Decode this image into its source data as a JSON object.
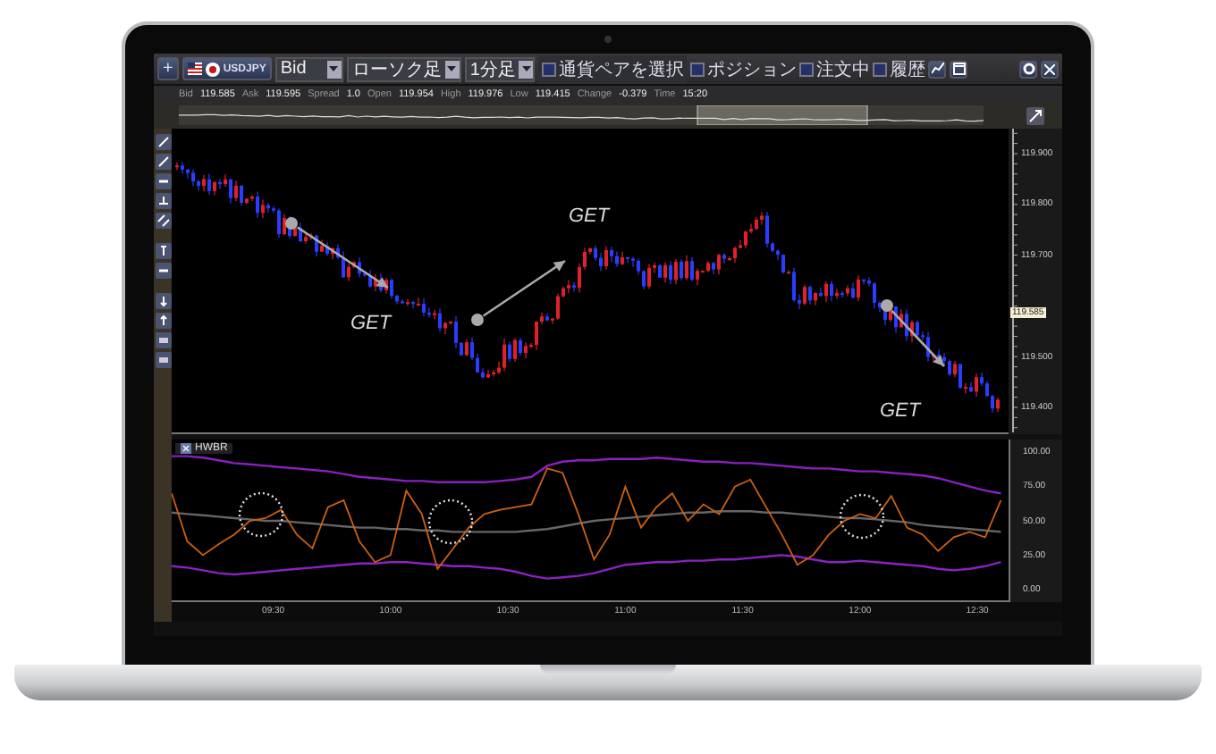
{
  "toolbar": {
    "add_button": "+",
    "pair": "USDJPY",
    "selects": [
      {
        "value": "Bid"
      },
      {
        "value": "ローソク足"
      },
      {
        "value": "1分足"
      }
    ],
    "pair_filter": {
      "label": "通貨ペアを選択",
      "checked": false
    },
    "toggles": [
      {
        "label": "ポジション",
        "checked": false
      },
      {
        "label": "注文中",
        "checked": false
      },
      {
        "label": "履歴",
        "checked": false
      }
    ]
  },
  "quote": [
    {
      "label": "Bid",
      "value": "119.585"
    },
    {
      "label": "Ask",
      "value": "119.595"
    },
    {
      "label": "Spread",
      "value": "1.0"
    },
    {
      "label": "Open",
      "value": "119.954"
    },
    {
      "label": "High",
      "value": "119.976"
    },
    {
      "label": "Low",
      "value": "119.415"
    },
    {
      "label": "Change",
      "value": "-0.379"
    },
    {
      "label": "Time",
      "value": "15:20"
    }
  ],
  "price_chart": {
    "axis_labels": [
      "119.900",
      "119.800",
      "119.700",
      "119.500",
      "119.400"
    ],
    "current_price": "119.585",
    "annotations": [
      {
        "text": "GET"
      },
      {
        "text": "GET"
      },
      {
        "text": "GET"
      }
    ]
  },
  "indicator": {
    "name": "HWBR",
    "chart_data": {
      "type": "line",
      "x": [
        9.067,
        9.133,
        9.2,
        9.267,
        9.333,
        9.4,
        9.467,
        9.533,
        9.6,
        9.667,
        9.733,
        9.8,
        9.867,
        9.933,
        10,
        10.067,
        10.133,
        10.2,
        10.267,
        10.333,
        10.4,
        10.467,
        10.533,
        10.6,
        10.667,
        10.733,
        10.8,
        10.867,
        10.933,
        11,
        11.067,
        11.133,
        11.2,
        11.267,
        11.333,
        11.4,
        11.467,
        11.533,
        11.6,
        11.667,
        11.733,
        11.8,
        11.867,
        11.933,
        12,
        12.067,
        12.133,
        12.2,
        12.267,
        12.333,
        12.4,
        12.467,
        12.533,
        12.6
      ],
      "series": [
        {
          "color": "#8a20c0",
          "values": [
            97,
            97,
            96,
            94,
            92,
            91,
            90,
            89,
            88,
            87,
            86,
            84,
            82,
            81,
            80,
            79,
            79,
            78,
            78,
            78,
            78,
            79,
            80,
            82,
            90,
            93,
            94,
            94,
            95,
            95,
            95,
            96,
            95,
            94,
            93,
            93,
            92,
            92,
            91,
            90,
            89,
            88,
            88,
            87,
            86,
            86,
            85,
            84,
            83,
            81,
            78,
            75,
            72,
            70
          ]
        },
        {
          "color": "#8c22c4",
          "values": [
            17,
            16,
            14,
            12,
            11,
            12,
            13,
            14,
            15,
            16,
            17,
            18,
            19,
            19,
            20,
            20,
            19,
            18,
            17,
            17,
            16,
            15,
            13,
            10,
            8,
            9,
            10,
            12,
            15,
            18,
            19,
            20,
            20,
            21,
            21,
            22,
            22,
            23,
            24,
            25,
            24,
            22,
            20,
            20,
            21,
            20,
            19,
            18,
            17,
            15,
            14,
            15,
            17,
            20
          ]
        },
        {
          "color": "#666666",
          "values": [
            56,
            55,
            54,
            53,
            52,
            51,
            50,
            50,
            49,
            48,
            47,
            46,
            45,
            45,
            44,
            44,
            43,
            43,
            42,
            42,
            42,
            42,
            42,
            43,
            44,
            46,
            48,
            50,
            51,
            52,
            53,
            54,
            55,
            56,
            56,
            57,
            57,
            57,
            56,
            56,
            55,
            54,
            53,
            52,
            52,
            51,
            50,
            49,
            47,
            46,
            45,
            44,
            43,
            42
          ]
        },
        {
          "color": "#d06010",
          "values": [
            70,
            35,
            25,
            33,
            40,
            50,
            52,
            58,
            40,
            30,
            60,
            65,
            35,
            20,
            25,
            72,
            55,
            15,
            30,
            45,
            55,
            58,
            60,
            62,
            88,
            85,
            55,
            22,
            40,
            75,
            45,
            60,
            70,
            50,
            62,
            55,
            75,
            80,
            60,
            40,
            18,
            25,
            40,
            50,
            55,
            52,
            68,
            45,
            40,
            28,
            38,
            42,
            38,
            65
          ]
        }
      ],
      "xlim": [
        9.067,
        12.633
      ],
      "ylim": [
        -9.1,
        109.1
      ],
      "xticks": [
        {
          "value": 9.5,
          "label": "09:30"
        },
        {
          "value": 10,
          "label": "10:00"
        },
        {
          "value": 10.5,
          "label": "10:30"
        },
        {
          "value": 11,
          "label": "11:00"
        },
        {
          "value": 11.5,
          "label": "11:30"
        },
        {
          "value": 12,
          "label": "12:00"
        },
        {
          "value": 12.5,
          "label": "12:30"
        }
      ],
      "yticks": [
        {
          "value": 100,
          "label": "100.00"
        },
        {
          "value": 75,
          "label": "75.00"
        },
        {
          "value": 50,
          "label": "50.00"
        },
        {
          "value": 25,
          "label": "25.00"
        },
        {
          "value": 0,
          "label": "0.00"
        }
      ]
    }
  }
}
